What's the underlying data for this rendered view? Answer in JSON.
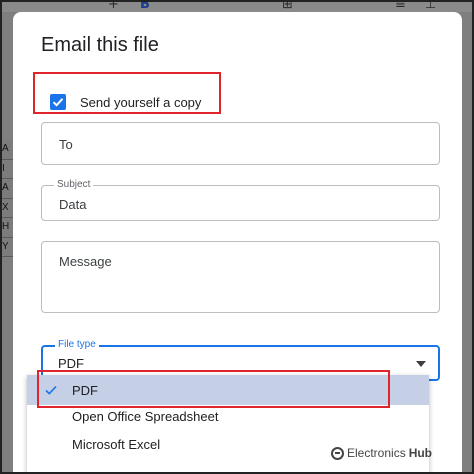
{
  "dialog": {
    "title": "Email this file",
    "send_copy": {
      "label": "Send yourself a copy",
      "checked": true
    },
    "to_field": {
      "placeholder": "To",
      "value": ""
    },
    "subject_field": {
      "label": "Subject",
      "value": "Data"
    },
    "message_field": {
      "placeholder": "Message",
      "value": ""
    },
    "file_type": {
      "label": "File type",
      "value": "PDF",
      "options": [
        {
          "label": "PDF",
          "selected": true
        },
        {
          "label": "Open Office Spreadsheet",
          "selected": false
        },
        {
          "label": "Microsoft Excel",
          "selected": false
        }
      ]
    }
  },
  "background": {
    "row_letters": [
      "A",
      "I",
      "A",
      "X",
      "H",
      "Y"
    ]
  },
  "watermark": {
    "brand": "Electronics",
    "suffix": "Hub"
  },
  "colors": {
    "accent": "#1a73e8",
    "selected_option": "#c5d0e6",
    "highlight": "#e0232c"
  },
  "icons": [
    "check-icon",
    "chevron-down-icon",
    "electronics-hub-logo-icon"
  ]
}
